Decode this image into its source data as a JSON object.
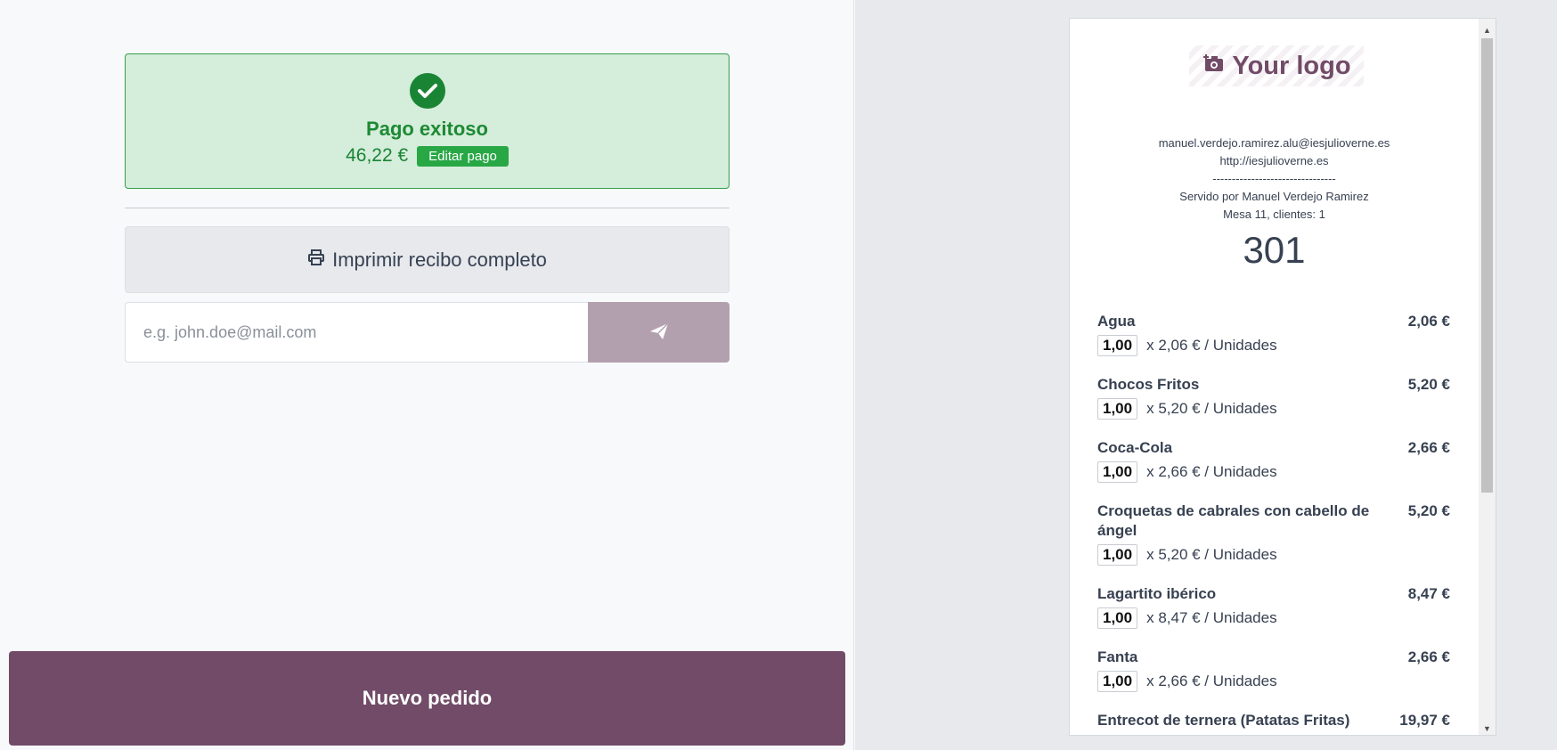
{
  "payment": {
    "title": "Pago exitoso",
    "amount": "46,22 €",
    "edit_label": "Editar pago"
  },
  "actions": {
    "print_label": "Imprimir recibo completo",
    "email_placeholder": "e.g. john.doe@mail.com",
    "new_order_label": "Nuevo pedido"
  },
  "receipt": {
    "logo_text": "Your logo",
    "email": "manuel.verdejo.ramirez.alu@iesjulioverne.es",
    "website": "http://iesjulioverne.es",
    "separator": "--------------------------------",
    "served_by": "Servido por Manuel Verdejo Ramirez",
    "table_info": "Mesa 11, clientes: 1",
    "order_number": "301",
    "lines": [
      {
        "name": "Agua",
        "price": "2,06 €",
        "qty": "1,00",
        "unit_detail": "x 2,06 € / Unidades"
      },
      {
        "name": "Chocos Fritos",
        "price": "5,20 €",
        "qty": "1,00",
        "unit_detail": "x 5,20 € / Unidades"
      },
      {
        "name": "Coca-Cola",
        "price": "2,66 €",
        "qty": "1,00",
        "unit_detail": "x 2,66 € / Unidades"
      },
      {
        "name": "Croquetas de cabrales con cabello de ángel",
        "price": "5,20 €",
        "qty": "1,00",
        "unit_detail": "x 5,20 € / Unidades"
      },
      {
        "name": "Lagartito ibérico",
        "price": "8,47 €",
        "qty": "1,00",
        "unit_detail": "x 8,47 € / Unidades"
      },
      {
        "name": "Fanta",
        "price": "2,66 €",
        "qty": "1,00",
        "unit_detail": "x 2,66 € / Unidades"
      },
      {
        "name": "Entrecot de ternera (Patatas Fritas)",
        "price": "19,97 €"
      }
    ]
  },
  "colors": {
    "brand": "#714b67",
    "success": "#198534",
    "success_bg": "#d5eddb",
    "send_button": "#b3a0ae"
  },
  "icons": {
    "check": "check-circle-icon",
    "print": "printer-icon",
    "send": "paper-plane-icon",
    "logo": "camera-plus-icon"
  }
}
